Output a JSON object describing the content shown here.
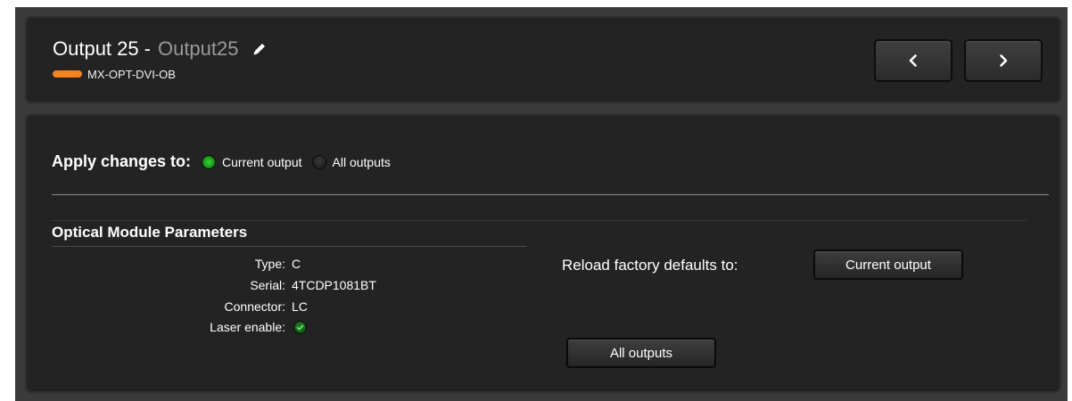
{
  "header": {
    "title": "Output 25",
    "separator": "-",
    "output_name": "Output25",
    "edit_icon": "pencil-icon",
    "module_code": "MX-OPT-DVI-OB",
    "module_color": "#f58220",
    "prev_icon": "chevron-left-icon",
    "next_icon": "chevron-right-icon"
  },
  "apply": {
    "label": "Apply changes to:",
    "options": [
      {
        "label": "Current output",
        "selected": true
      },
      {
        "label": "All outputs",
        "selected": false
      }
    ]
  },
  "optical": {
    "title": "Optical Module Parameters",
    "params": [
      {
        "label": "Type:",
        "value": "C"
      },
      {
        "label": "Serial:",
        "value": "4TCDP1081BT"
      },
      {
        "label": "Connector:",
        "value": "LC"
      },
      {
        "label": "Laser enable:",
        "value_icon": "check-circle-icon",
        "enabled": true
      }
    ]
  },
  "reload": {
    "label": "Reload factory defaults to:",
    "current_button": "Current output",
    "all_button": "All outputs"
  },
  "colors": {
    "accent_green": "#22b022",
    "panel_bg": "#232323",
    "frame_bg": "#3a3a3a"
  }
}
